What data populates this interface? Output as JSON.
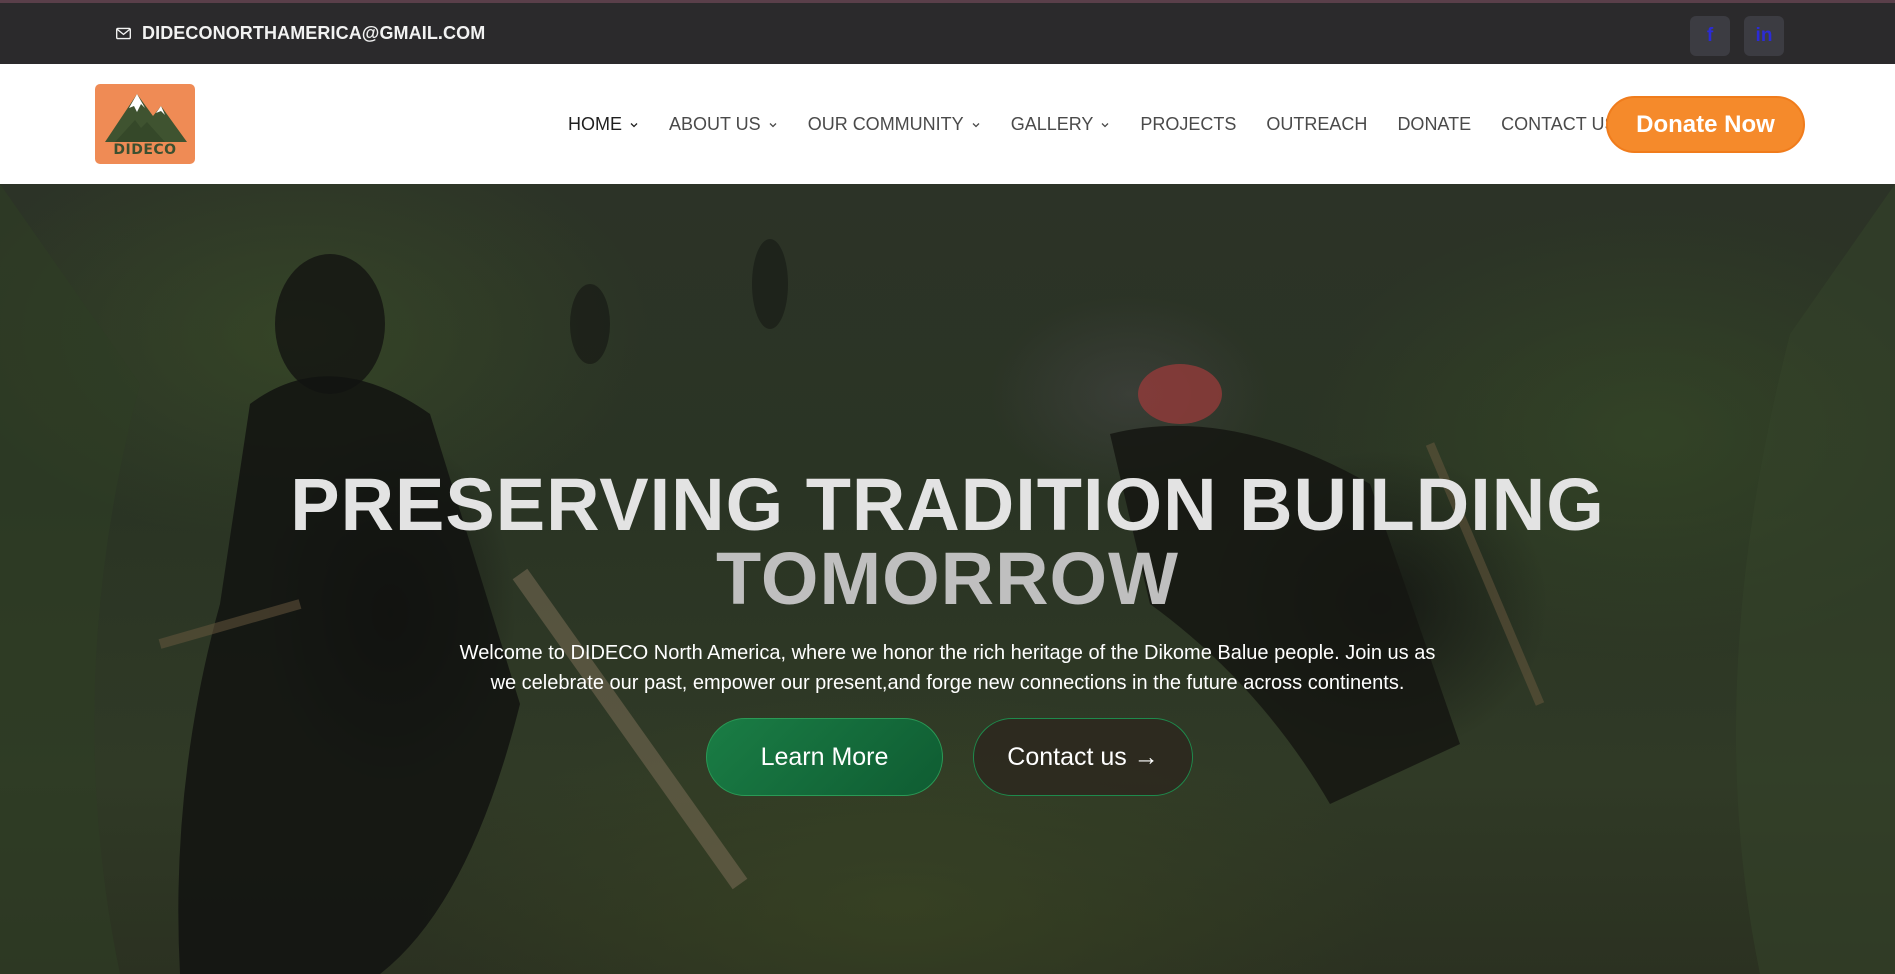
{
  "topbar": {
    "email": "DIDECONORTHAMERICA@GMAIL.COM",
    "social": [
      {
        "name": "facebook-icon",
        "glyph": "f"
      },
      {
        "name": "linkedin-icon",
        "glyph": "in"
      }
    ]
  },
  "header": {
    "logo_text": "DIDECO",
    "nav": [
      {
        "label": "HOME",
        "dropdown": true,
        "active": true
      },
      {
        "label": "ABOUT US",
        "dropdown": true
      },
      {
        "label": "OUR COMMUNITY",
        "dropdown": true
      },
      {
        "label": "GALLERY",
        "dropdown": true
      },
      {
        "label": "PROJECTS",
        "dropdown": false
      },
      {
        "label": "OUTREACH",
        "dropdown": false
      },
      {
        "label": "DONATE",
        "dropdown": false
      },
      {
        "label": "CONTACT US",
        "dropdown": false
      }
    ],
    "donate_label": "Donate Now"
  },
  "hero": {
    "title_line1": "PRESERVING TRADITION BUILDING",
    "title_line2": "TOMORROW",
    "subtitle_line1": "Welcome to DIDECO North America, where we honor the rich heritage of the Dikome Balue people. Join us as",
    "subtitle_line2": "we celebrate our past, empower our present,and forge new connections in the future across continents.",
    "learn_more_label": "Learn More",
    "contact_label": "Contact us →"
  },
  "colors": {
    "accent_orange": "#f58a2b",
    "accent_green": "#1a7d45",
    "topbar_bg": "#2b2a2c",
    "social_icon": "#2b2bd6"
  }
}
